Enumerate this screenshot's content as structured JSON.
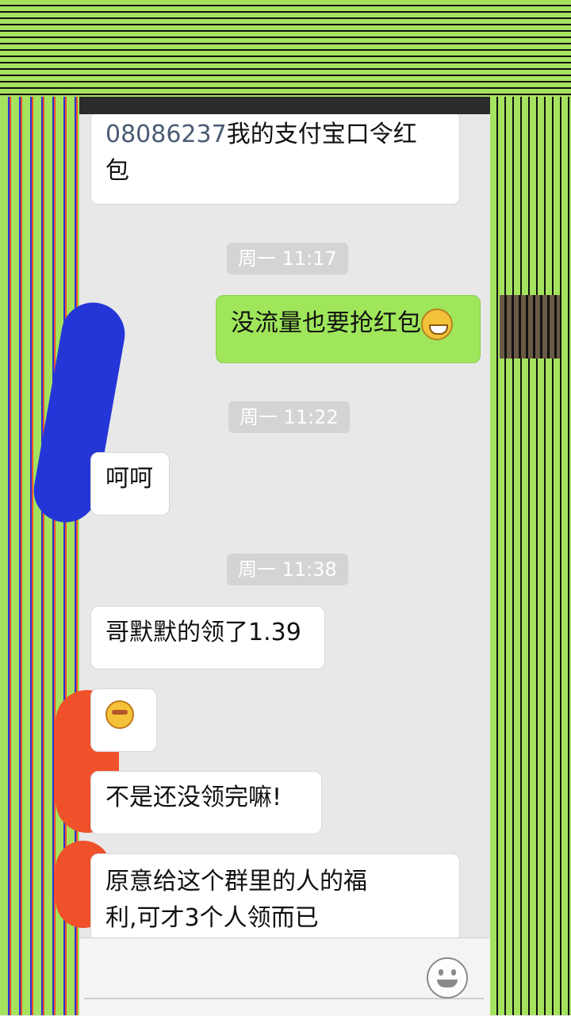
{
  "messages": [
    {
      "side": "left",
      "number": "08086237",
      "text": "我的支付宝口令红",
      "text_line2": "包"
    },
    {
      "type": "time",
      "text": "周一 11:17"
    },
    {
      "side": "right",
      "text": "没流量也要抢红包",
      "emoji": "grin-emoji-icon"
    },
    {
      "type": "time",
      "text": "周一 11:22"
    },
    {
      "side": "left",
      "text": "呵呵"
    },
    {
      "type": "time",
      "text": "周一 11:38"
    },
    {
      "side": "left",
      "text": "哥默默的领了1.39"
    },
    {
      "side": "left",
      "emoji": "smirk-emoji-icon"
    },
    {
      "side": "left",
      "text": "不是还没领完嘛!"
    },
    {
      "side": "left",
      "text": "原意给这个群里的人的福",
      "text_line2": "利,可才3个人领而已"
    }
  ],
  "input_bar": {
    "icon": "emoji-icon"
  }
}
